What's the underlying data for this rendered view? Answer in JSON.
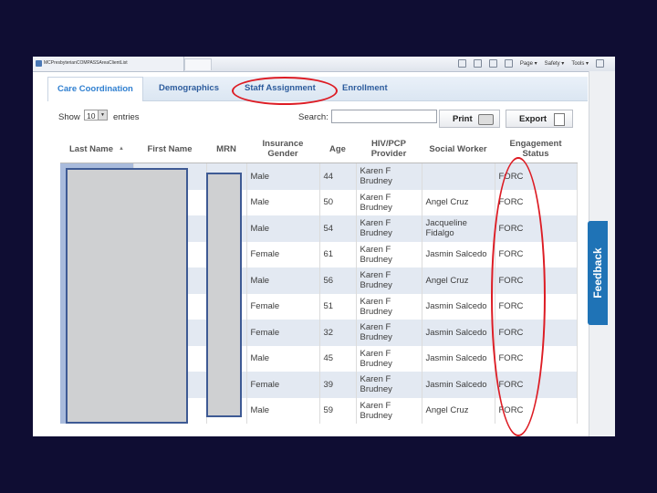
{
  "browser": {
    "tab_title": "MCPresbyterianCOMPASSAreaClientList",
    "menu": [
      "Page ▾",
      "Safety ▾",
      "Tools ▾"
    ]
  },
  "tabs": [
    "Care Coordination",
    "Demographics",
    "Staff Assignment",
    "Enrollment"
  ],
  "controls": {
    "show_label": "Show",
    "entries_value": "10",
    "entries_label": "entries",
    "search_label": "Search:",
    "search_value": "",
    "print_label": "Print",
    "export_label": "Export"
  },
  "feedback_label": "Feedback",
  "table": {
    "headers": [
      "Last Name",
      "First Name",
      "MRN",
      "Insurance Gender",
      "Age",
      "HIV/PCP Provider",
      "Social Worker",
      "Engagement Status"
    ],
    "rows": [
      {
        "gender": "Male",
        "age": "44",
        "provider": "Karen F Brudney",
        "worker": "",
        "status": "FORC"
      },
      {
        "gender": "Male",
        "age": "50",
        "provider": "Karen F Brudney",
        "worker": "Angel Cruz",
        "status": "FORC"
      },
      {
        "gender": "Male",
        "age": "54",
        "provider": "Karen F Brudney",
        "worker": "Jacqueline Fidalgo",
        "status": "FORC"
      },
      {
        "gender": "Female",
        "age": "61",
        "provider": "Karen F Brudney",
        "worker": "Jasmin Salcedo",
        "status": "FORC"
      },
      {
        "gender": "Male",
        "age": "56",
        "provider": "Karen F Brudney",
        "worker": "Angel Cruz",
        "status": "FORC"
      },
      {
        "gender": "Female",
        "age": "51",
        "provider": "Karen F Brudney",
        "worker": "Jasmin Salcedo",
        "status": "FORC"
      },
      {
        "gender": "Female",
        "age": "32",
        "provider": "Karen F Brudney",
        "worker": "Jasmin Salcedo",
        "status": "FORC"
      },
      {
        "gender": "Male",
        "age": "45",
        "provider": "Karen F Brudney",
        "worker": "Jasmin Salcedo",
        "status": "FORC"
      },
      {
        "gender": "Female",
        "age": "39",
        "provider": "Karen F Brudney",
        "worker": "Jasmin Salcedo",
        "status": "FORC"
      },
      {
        "gender": "Male",
        "age": "59",
        "provider": "Karen F Brudney",
        "worker": "Angel Cruz",
        "status": "FORC"
      }
    ]
  },
  "colors": {
    "annotation": "#dd1c24",
    "tab_text": "#2d5c9d",
    "active_tab_text": "#2f7fd0",
    "feedback_bg": "#1f73b6",
    "slide_bg": "#0f0d33"
  }
}
